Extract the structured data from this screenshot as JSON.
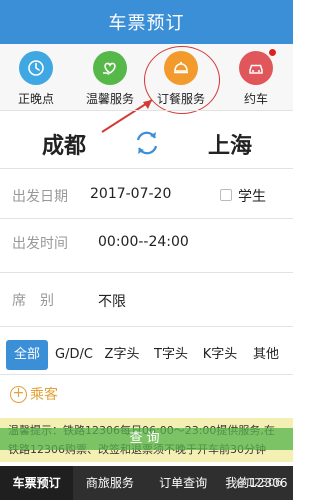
{
  "header": {
    "title": "车票预订"
  },
  "services": [
    {
      "label": "正晚点",
      "icon": "clock-icon",
      "color": "#3fa7e1"
    },
    {
      "label": "温馨服务",
      "icon": "heart-hand-icon",
      "color": "#56b848"
    },
    {
      "label": "订餐服务",
      "icon": "meal-icon",
      "color": "#f29b2c"
    },
    {
      "label": "约车",
      "icon": "car-icon",
      "color": "#e0565b",
      "badge": true
    }
  ],
  "route": {
    "from": "成都",
    "to": "上海",
    "swap_icon": "swap-icon"
  },
  "form": {
    "date_label": "出发日期",
    "date_value": "2017-07-20",
    "student_label": "学生",
    "time_label": "出发时间",
    "time_value": "00:00--24:00",
    "seat_label": "席　别",
    "seat_value": "不限"
  },
  "filters": [
    "全部",
    "G/D/C",
    "Z字头",
    "T字头",
    "K字头",
    "其他"
  ],
  "passenger": {
    "add_label": "乘客"
  },
  "notice": {
    "text": "温馨提示：铁路12306每日06:00～23:00提供服务,在铁路12306购票、改签和退票须不晚于开车前30分钟",
    "button": "查询"
  },
  "bottom_nav": [
    "车票预订",
    "商旅服务",
    "订单查询",
    "我的12306"
  ],
  "watermark": "@12306",
  "colors": {
    "primary": "#3a8fd6",
    "highlight": "#d23a35",
    "notice_bg": "#f4efb3"
  }
}
